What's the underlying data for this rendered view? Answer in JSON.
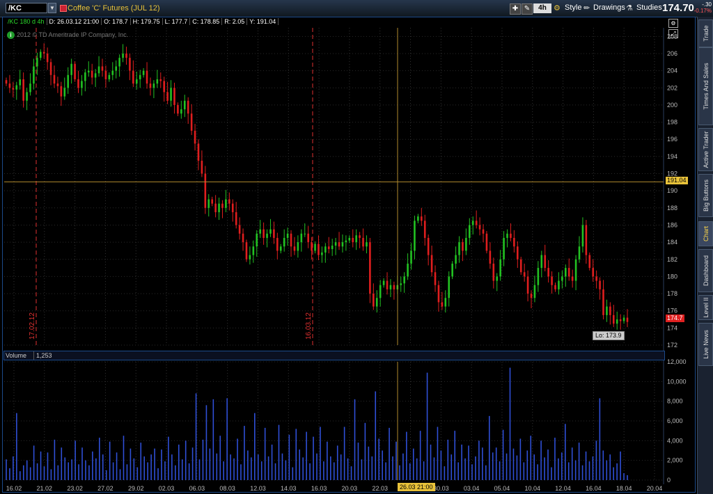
{
  "toolbar": {
    "symbol": "/KC",
    "instrument_description": "Coffee 'C' Futures (JUL 12)",
    "aggregation": "4h",
    "style_label": "Style",
    "drawings_label": "Drawings",
    "studies_label": "Studies",
    "last_price": "174.70",
    "net_change": "-.30",
    "pct_change": "-0.17%"
  },
  "info_bar": {
    "symbol": "/KC 180 d 4h",
    "date": "D: 26.03.12 21:00",
    "open": "O: 178.7",
    "high": "H: 179.75",
    "low": "L: 177.7",
    "close": "C: 178.85",
    "range": "R: 2.05",
    "y": "Y: 191.04"
  },
  "copyright": "2012 © TD Ameritrade IP Company, Inc.",
  "price_axis": [
    "208",
    "206",
    "204",
    "202",
    "200",
    "198",
    "196",
    "194",
    "192",
    "190",
    "188",
    "186",
    "184",
    "182",
    "180",
    "178",
    "176",
    "174",
    "172"
  ],
  "volume_axis": [
    "12,000",
    "10,000",
    "8,000",
    "6,000",
    "4,000",
    "2,000",
    "0"
  ],
  "time_axis": [
    "16.02",
    "21.02",
    "23.02",
    "27.02",
    "29.02",
    "02.03",
    "06.03",
    "08.03",
    "12.03",
    "14.03",
    "16.03",
    "20.03",
    "22.03",
    "26.03",
    "30.03",
    "03.04",
    "05.04",
    "10.04",
    "12.04",
    "16.04",
    "18.04",
    "20.04"
  ],
  "crosshair": {
    "price_badge": "191.04",
    "time_badge": "26.03 21:00"
  },
  "last_badge": "174.7",
  "low_label": "Lo: 173.9",
  "markers": [
    {
      "label": "17.02.12"
    },
    {
      "label": "16.03.12"
    }
  ],
  "volume": {
    "label": "Volume",
    "value": "1,253"
  },
  "side_tabs": [
    "Trade",
    "Times And Sales",
    "Active Trader",
    "Big Buttons",
    "Chart",
    "Dashboard",
    "Level II",
    "Live News"
  ],
  "colors": {
    "up_candle": "#22c222",
    "down_candle": "#e01e1e",
    "volume_bar": "#2f4fd6",
    "crosshair": "#b08a2e",
    "marker": "#e03030"
  },
  "chart_data": {
    "type": "candlestick",
    "ylim": [
      172,
      209
    ],
    "y_ticks": [
      172,
      174,
      176,
      178,
      180,
      182,
      184,
      186,
      188,
      190,
      192,
      194,
      196,
      198,
      200,
      202,
      204,
      206,
      208
    ],
    "volume_ylim": [
      0,
      12000
    ],
    "volume_ticks": [
      0,
      2000,
      4000,
      6000,
      8000,
      10000,
      12000
    ],
    "closes": [
      202.5,
      202.0,
      201.8,
      202.3,
      203.0,
      200.5,
      201.5,
      202.5,
      204.5,
      205.5,
      206.2,
      206.0,
      205.0,
      203.5,
      202.5,
      202.2,
      201.0,
      202.0,
      203.5,
      204.8,
      203.0,
      202.0,
      202.8,
      203.8,
      204.0,
      203.2,
      203.7,
      204.5,
      204.0,
      203.0,
      203.5,
      204.0,
      204.5,
      205.5,
      206.0,
      205.5,
      204.0,
      202.5,
      203.0,
      203.5,
      204.0,
      202.5,
      202.0,
      202.5,
      203.0,
      202.8,
      201.5,
      200.5,
      202.0,
      200.0,
      199.0,
      199.5,
      200.5,
      199.0,
      197.0,
      195.5,
      193.5,
      192.0,
      188.0,
      189.0,
      188.5,
      187.5,
      188.5,
      188.0,
      189.0,
      188.5,
      187.5,
      186.0,
      185.0,
      184.0,
      182.0,
      182.5,
      183.5,
      185.0,
      185.5,
      184.5,
      185.0,
      185.5,
      184.5,
      183.0,
      183.5,
      184.5,
      185.0,
      183.5,
      183.0,
      184.0,
      185.0,
      185.0,
      184.0,
      183.0,
      183.8,
      182.5,
      182.8,
      183.5,
      183.2,
      183.6,
      184.0,
      183.5,
      184.0,
      184.2,
      184.5,
      184.0,
      184.8,
      184.5,
      183.5,
      184.0,
      178.0,
      176.5,
      177.5,
      179.0,
      179.5,
      178.5,
      179.0,
      178.5,
      179.0,
      179.2,
      180.0,
      181.5,
      183.0,
      186.5,
      187.0,
      186.5,
      184.5,
      182.5,
      180.5,
      179.0,
      177.0,
      176.5,
      177.5,
      180.0,
      181.5,
      182.5,
      184.0,
      183.0,
      184.5,
      186.0,
      186.5,
      186.0,
      185.5,
      185.0,
      183.0,
      181.5,
      179.5,
      180.0,
      182.0,
      184.5,
      185.0,
      184.5,
      183.5,
      182.0,
      180.5,
      180.0,
      178.0,
      177.5,
      179.0,
      181.0,
      182.5,
      181.0,
      180.0,
      179.0,
      178.5,
      179.5,
      180.0,
      181.0,
      180.0,
      179.5,
      182.0,
      183.5,
      186.0,
      182.5,
      181.0,
      180.0,
      179.5,
      178.5,
      175.5,
      176.5,
      175.5,
      174.5,
      175.0,
      174.8,
      175.2,
      174.7
    ],
    "volumes": [
      2100,
      1200,
      2400,
      6800,
      900,
      1500,
      2000,
      1300,
      3500,
      1700,
      2900,
      1400,
      2800,
      1100,
      4100,
      1500,
      3300,
      2300,
      1800,
      2100,
      4000,
      1600,
      3300,
      2000,
      1500,
      2900,
      2200,
      4300,
      2600,
      1000,
      3900,
      1800,
      2800,
      1100,
      4500,
      1600,
      3200,
      2200,
      1300,
      3800,
      2400,
      1800,
      2600,
      3200,
      1200,
      3100,
      1900,
      4400,
      2600,
      1500,
      3600,
      2100,
      4000,
      1700,
      3300,
      8800,
      2100,
      4100,
      7600,
      3200,
      8200,
      2700,
      4500,
      1900,
      8300,
      2600,
      2200,
      4200,
      1600,
      5500,
      3000,
      2300,
      6800,
      2600,
      1900,
      5300,
      2400,
      3600,
      1700,
      5600,
      2700,
      2000,
      4600,
      1300,
      5200,
      3100,
      2300,
      4900,
      1700,
      4400,
      2700,
      5400,
      1900,
      3900,
      2400,
      1800,
      3500,
      2600,
      5400,
      2200,
      1400,
      8200,
      3800,
      2100,
      5800,
      3400,
      2400,
      9000,
      4200,
      3000,
      1800,
      5300,
      2400,
      3900,
      1500,
      2700,
      4900,
      1700,
      3200,
      2200,
      5000,
      1900,
      10900,
      3600,
      2300,
      5400,
      3000,
      1400,
      4100,
      2600,
      5000,
      1800,
      3600,
      2200,
      3500,
      1600,
      2400,
      4000,
      3300,
      1500,
      6500,
      2800,
      3300,
      1900,
      5100,
      2700,
      11400,
      3200,
      2500,
      4200,
      1800,
      3000,
      4500,
      2600,
      1600,
      4000,
      2300,
      3100,
      1300,
      4300,
      2200,
      2800,
      5700,
      1800,
      3300,
      2000,
      3800,
      1500,
      2900,
      1900,
      2400,
      4000,
      8300,
      3000,
      2000,
      2600,
      1300,
      1700,
      2900,
      700,
      500
    ]
  }
}
